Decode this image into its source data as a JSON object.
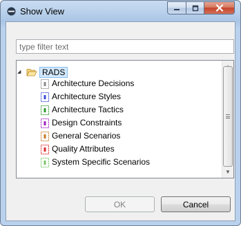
{
  "window": {
    "title": "Show View"
  },
  "filter": {
    "value": "",
    "placeholder": "type filter text"
  },
  "tree": {
    "root": {
      "label": "RADS",
      "icon": "folder-open-icon",
      "expanded": true,
      "selected": true
    },
    "items": [
      {
        "label": "Architecture Decisions",
        "icon": "view-icon",
        "color": "#8a8a8a"
      },
      {
        "label": "Architecture Styles",
        "icon": "view-icon",
        "color": "#3a4cd8"
      },
      {
        "label": "Architecture Tactics",
        "icon": "view-icon",
        "color": "#2f9a2f"
      },
      {
        "label": "Design Constraints",
        "icon": "view-icon",
        "color": "#a020c0"
      },
      {
        "label": "General Scenarios",
        "icon": "view-icon",
        "color": "#c87a2a"
      },
      {
        "label": "Quality Attributes",
        "icon": "view-icon",
        "color": "#e02a2a"
      },
      {
        "label": "System Specific Scenarios",
        "icon": "view-icon",
        "color": "#7ac86a"
      }
    ]
  },
  "buttons": {
    "ok_label": "OK",
    "cancel_label": "Cancel"
  }
}
